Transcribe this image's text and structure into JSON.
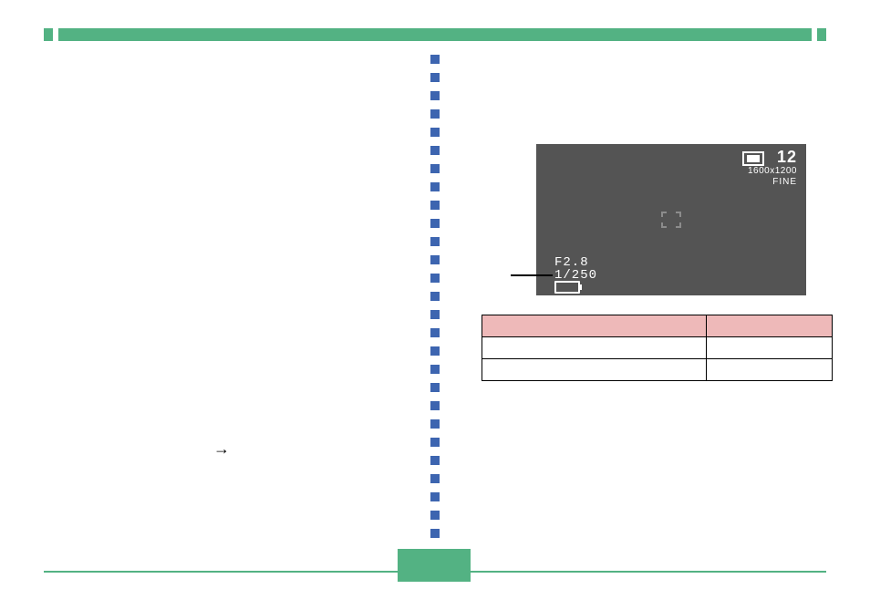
{
  "camera_display": {
    "frames_remaining": "12",
    "resolution": "1600x1200",
    "quality": "FINE",
    "aperture": "F2.8",
    "shutter_speed": "1/250"
  },
  "arrow_glyph": "→"
}
